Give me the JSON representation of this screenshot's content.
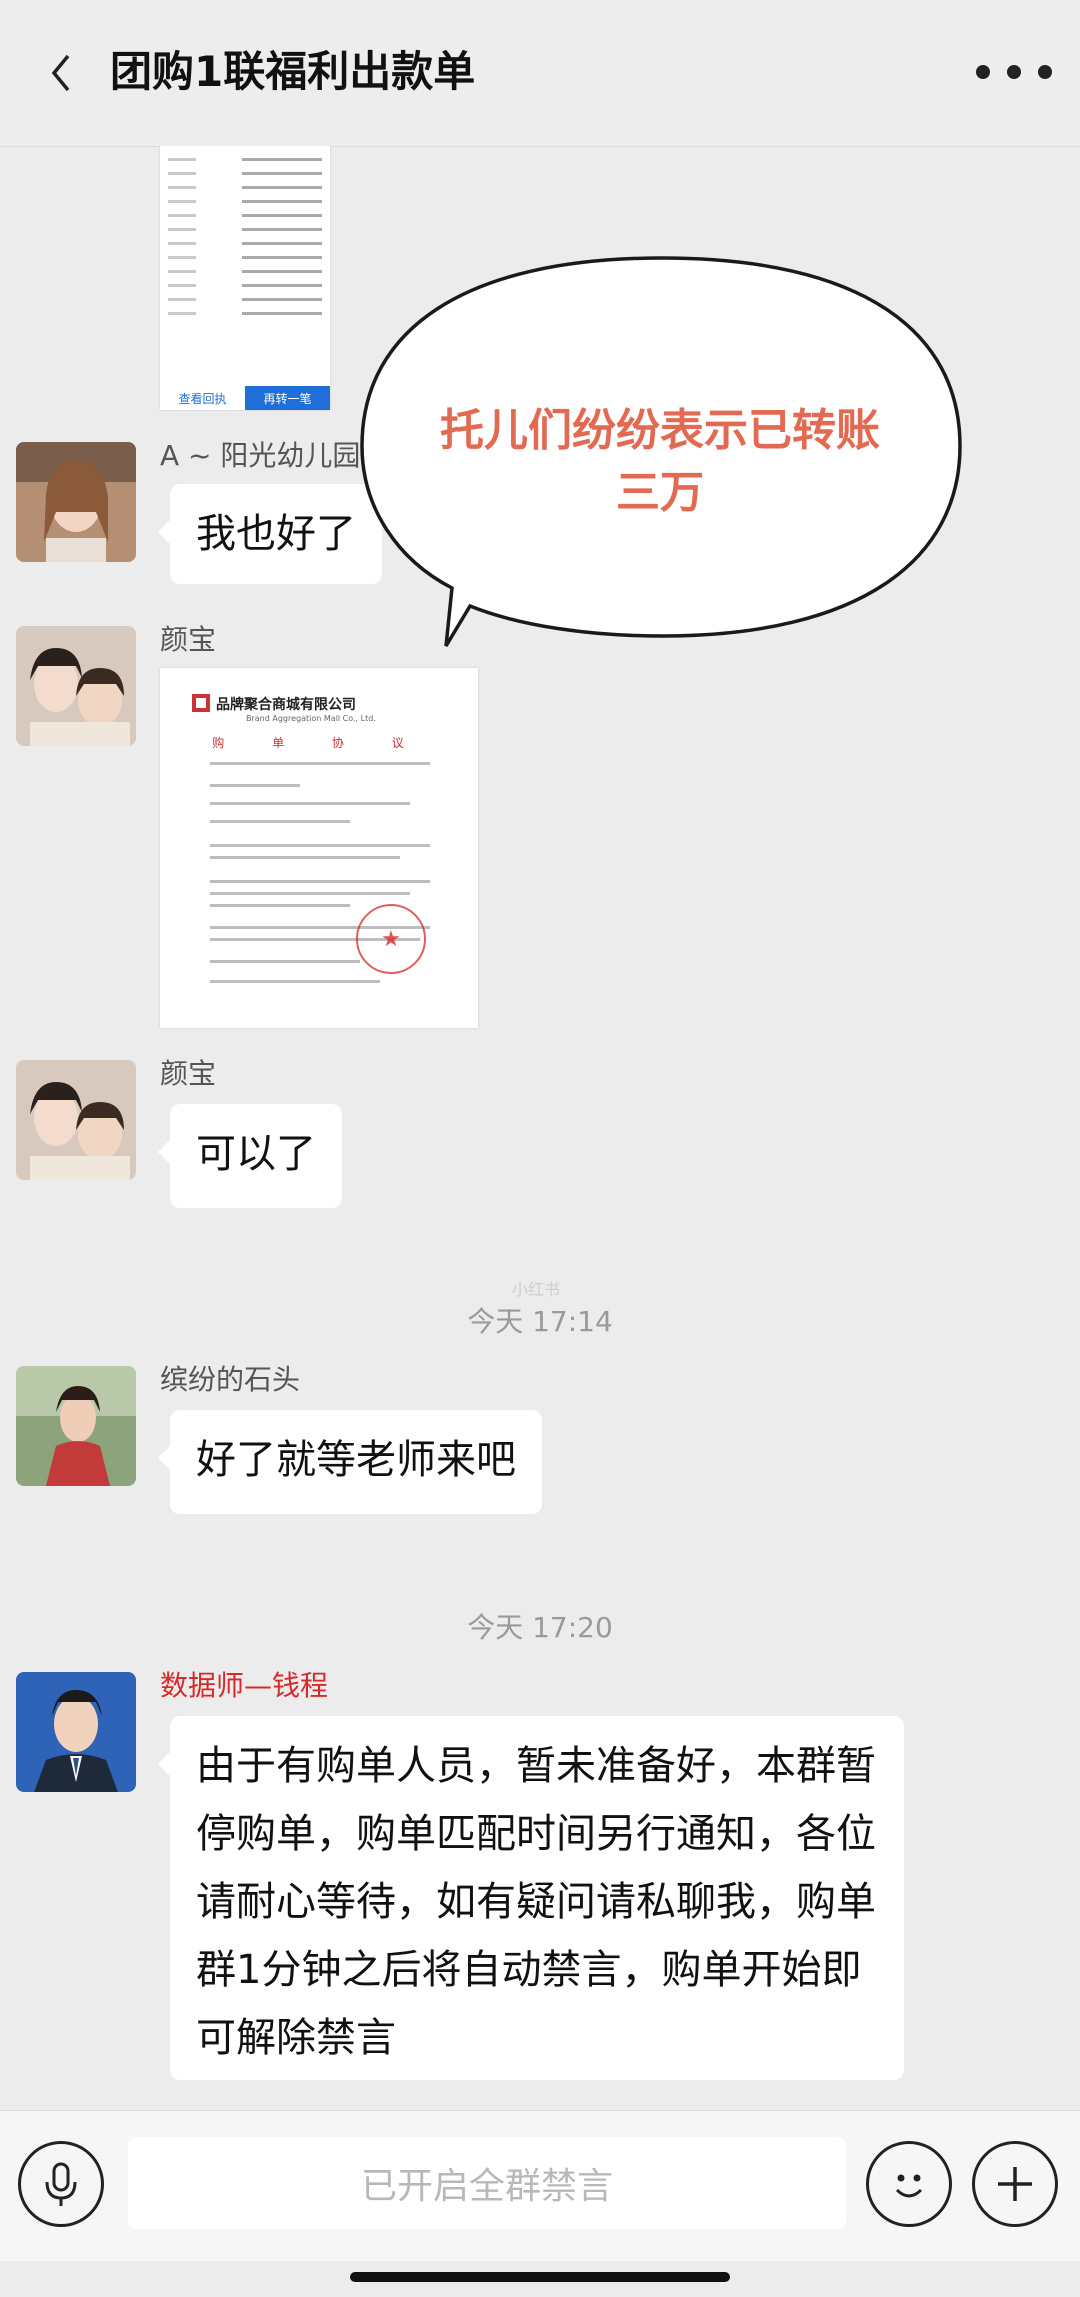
{
  "header": {
    "title": "团购1联福利出款单"
  },
  "receipt": {
    "button_view": "查看回执",
    "button_again": "再转一笔"
  },
  "messages": [
    {
      "sender": "A ~ 阳光幼儿园",
      "text": "我也好了"
    },
    {
      "sender": "颜宝",
      "text": ""
    },
    {
      "sender": "颜宝",
      "text": "可以了"
    },
    {
      "sender": "缤纷的石头",
      "text": "好了就等老师来吧"
    },
    {
      "sender": "数据师—钱程",
      "text": "由于有购单人员，暂未准备好，本群暂停购单，购单匹配时间另行通知，各位请耐心等待，如有疑问请私聊我，购单群1分钟之后将自动禁言，购单开始即可解除禁言"
    }
  ],
  "timestamps": [
    "今天 17:14",
    "今天 17:20"
  ],
  "document": {
    "company": "品牌聚合商城有限公司",
    "company_en": "Brand Aggregation Mall Co., Ltd.",
    "doc_title": "购 单 协 议"
  },
  "callout": {
    "text": "托儿们纷纷表示已转账三万"
  },
  "watermark": "小红书",
  "input": {
    "placeholder": "已开启全群禁言"
  },
  "colors": {
    "chat_bg": "#ececec",
    "bubble_bg": "#ffffff",
    "callout_text": "#e36a52",
    "sender_highlight": "#d62a2a",
    "link_blue": "#1e6fd9"
  }
}
